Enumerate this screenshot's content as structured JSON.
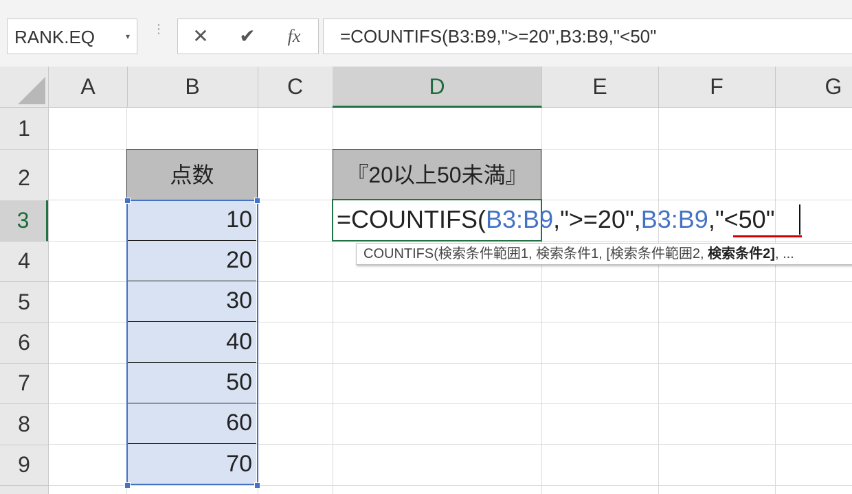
{
  "formula_bar": {
    "name_box": "RANK.EQ",
    "cancel_symbol": "✕",
    "enter_symbol": "✔",
    "fx_symbol": "fx",
    "formula": "=COUNTIFS(B3:B9,\">=20\",B3:B9,\"<50\""
  },
  "columns": [
    "A",
    "B",
    "C",
    "D",
    "E",
    "F",
    "G"
  ],
  "selected_column": "D",
  "rows": [
    "1",
    "2",
    "3",
    "4",
    "5",
    "6",
    "7",
    "8",
    "9"
  ],
  "selected_row": "3",
  "cells": {
    "B2": "点数",
    "D2": "『20以上50未満』",
    "B_values": [
      "10",
      "20",
      "30",
      "40",
      "50",
      "60",
      "70"
    ]
  },
  "editing": {
    "cell": "D3",
    "parts": [
      "=COUNTIFS(",
      "B3:B9",
      ",\">=20\",",
      "B3:B9",
      ",",
      "\"<50\""
    ]
  },
  "tooltip": {
    "prefix": "COUNTIFS(検索条件範囲1, 検索条件1, [検索条件範囲2, ",
    "bold": "検索条件2]",
    "suffix": ", ..."
  },
  "colors": {
    "selection_green": "#217346",
    "reference_blue": "#4472c4",
    "range_fill": "#d9e2f3",
    "underline_red": "#d00000"
  }
}
